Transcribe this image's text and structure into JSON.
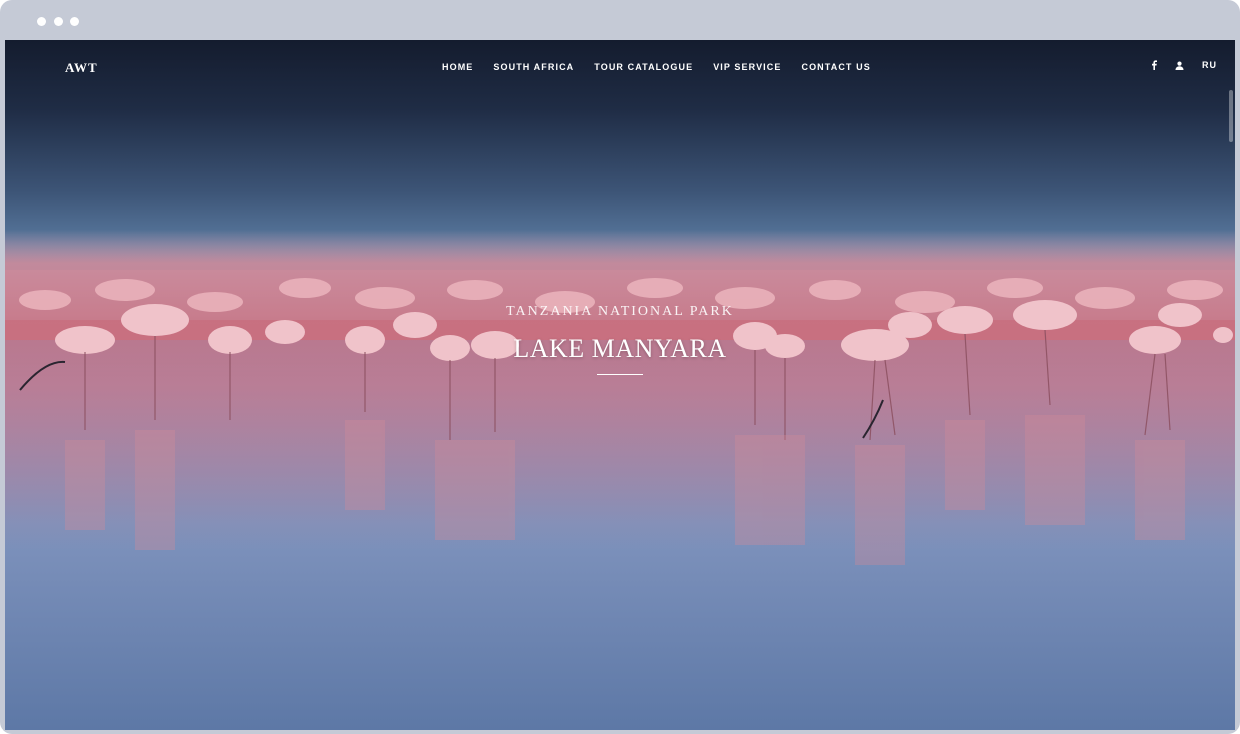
{
  "window": {
    "controls": [
      "dot",
      "dot",
      "dot"
    ]
  },
  "header": {
    "logo": "AWT",
    "nav": [
      {
        "label": "HOME"
      },
      {
        "label": "SOUTH AFRICA"
      },
      {
        "label": "TOUR CATALOGUE"
      },
      {
        "label": "VIP SERVICE"
      },
      {
        "label": "CONTACT US"
      }
    ],
    "tools": {
      "facebook_icon": "facebook-icon",
      "user_icon": "user-icon",
      "language": "RU"
    }
  },
  "hero": {
    "subtitle": "TANZANIA NATIONAL PARK",
    "title": "LAKE MANYARA",
    "background": "flamingos-on-lake-photo"
  },
  "colors": {
    "sky_top": "#141c2e",
    "water": "#7a97c2",
    "flamingo": "#e8a4ae",
    "frame": "#c5cad6"
  }
}
